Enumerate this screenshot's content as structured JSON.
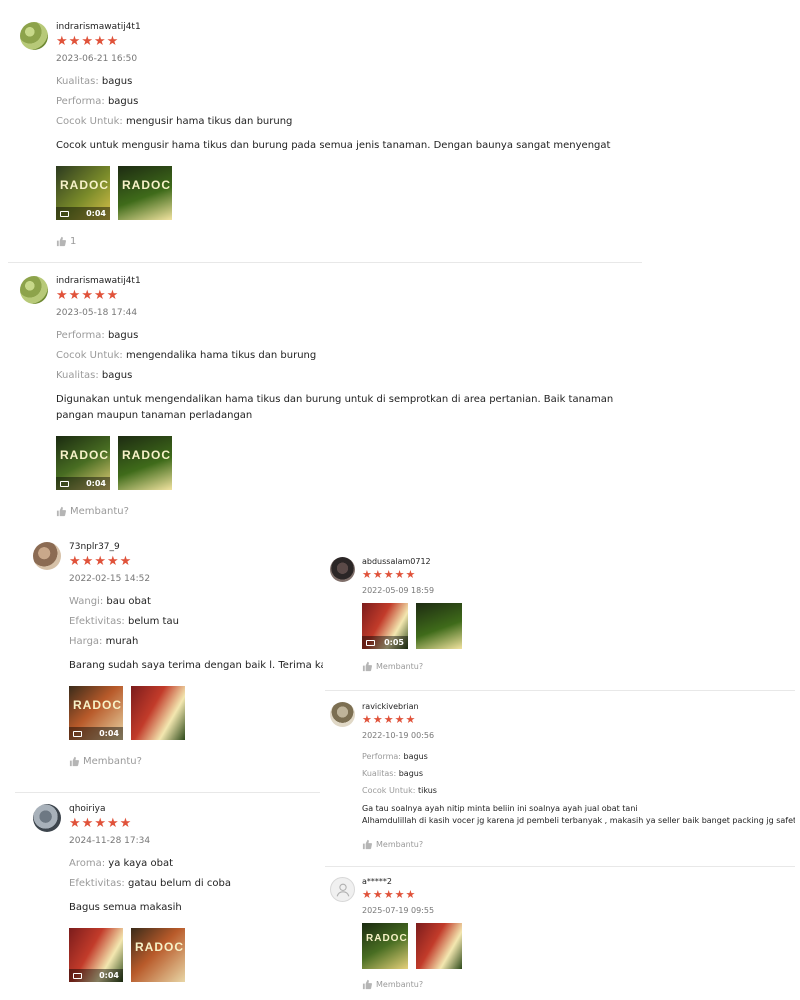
{
  "helpful_label": "Membantu?",
  "reviews": [
    {
      "username": "indrarismawatij4t1",
      "stars": 5,
      "date": "2023-06-21 16:50",
      "attrs": [
        {
          "label": "Kualitas:",
          "value": "bagus"
        },
        {
          "label": "Performa:",
          "value": "bagus"
        },
        {
          "label": "Cocok Untuk:",
          "value": "mengusir hama tikus dan burung"
        }
      ],
      "comment": "Cocok untuk mengusir hama tikus dan burung pada semua jenis tanaman. Dengan baunya sangat menyengat",
      "media": [
        {
          "brand": "RADOC",
          "duration": "0:04"
        },
        {
          "brand": "RADOC"
        }
      ],
      "helpful": "1"
    },
    {
      "username": "indrarismawatij4t1",
      "stars": 5,
      "date": "2023-05-18 17:44",
      "attrs": [
        {
          "label": "Performa:",
          "value": "bagus"
        },
        {
          "label": "Cocok Untuk:",
          "value": "mengendalika hama tikus dan burung"
        },
        {
          "label": "Kualitas:",
          "value": "bagus"
        }
      ],
      "comment": "Digunakan untuk mengendalikan hama tikus dan burung untuk di semprotkan di area pertanian. Baik tanaman pangan maupun tanaman perladangan",
      "media": [
        {
          "brand": "RADOC",
          "duration": "0:04"
        },
        {
          "brand": "RADOC"
        }
      ],
      "helpful": "Membantu?"
    },
    {
      "username": "73nplr37_9",
      "stars": 5,
      "date": "2022-02-15 14:52",
      "attrs": [
        {
          "label": "Wangi:",
          "value": "bau obat"
        },
        {
          "label": "Efektivitas:",
          "value": "belum tau"
        },
        {
          "label": "Harga:",
          "value": "murah"
        }
      ],
      "comment": "Barang sudah saya terima dengan baik l. Terima kasih",
      "media": [
        {
          "brand": "RADOC",
          "duration": "0:04"
        },
        {
          "brand": ""
        }
      ],
      "helpful": "Membantu?"
    },
    {
      "username": "qhoiriya",
      "stars": 5,
      "date": "2024-11-28 17:34",
      "attrs": [
        {
          "label": "Aroma:",
          "value": "ya kaya obat"
        },
        {
          "label": "Efektivitas:",
          "value": "gatau belum di coba"
        }
      ],
      "comment": "Bagus semua makasih",
      "media": [
        {
          "brand": "",
          "duration": "0:04"
        },
        {
          "brand": "RADOC"
        }
      ]
    },
    {
      "username": "abdussalam0712",
      "stars": 5,
      "date": "2022-05-09 18:59",
      "attrs": [],
      "comment": "",
      "media": [
        {
          "brand": "",
          "duration": "0:05"
        },
        {
          "brand": ""
        }
      ],
      "helpful": "Membantu?"
    },
    {
      "username": "ravickivebrian",
      "stars": 5,
      "date": "2022-10-19 00:56",
      "attrs": [
        {
          "label": "Performa:",
          "value": "bagus"
        },
        {
          "label": "Kualitas:",
          "value": "bagus"
        },
        {
          "label": "Cocok Untuk:",
          "value": "tikus"
        }
      ],
      "comment_lines": [
        "Ga tau soalnya ayah nitip minta beliin ini soalnya ayah jual obat tani",
        "Alhamdulillah di kasih vocer jg karena jd pembeli terbanyak , makasih ya seller baik banget packing jg safety"
      ],
      "helpful": "Membantu?"
    },
    {
      "username": "a*****2",
      "stars": 5,
      "date": "2025-07-19 09:55",
      "attrs": [],
      "comment": "",
      "media": [
        {
          "brand": "RADOC"
        },
        {
          "brand": ""
        }
      ],
      "helpful": "Membantu?"
    }
  ]
}
